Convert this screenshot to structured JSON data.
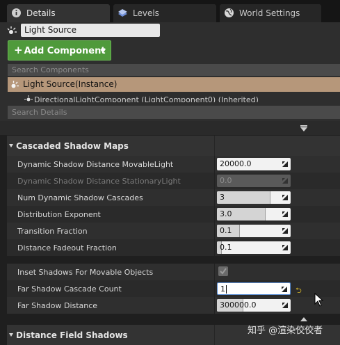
{
  "tabs": [
    {
      "label": "Details",
      "icon": "info-icon"
    },
    {
      "label": "Levels",
      "icon": "levels-icon"
    },
    {
      "label": "World Settings",
      "icon": "globe-icon"
    }
  ],
  "actor": {
    "name": "Light Source",
    "icon": "light-icon"
  },
  "toolbar": {
    "add_component_label": "Add Component",
    "plus": "+"
  },
  "search_components": {
    "placeholder": "Search Components"
  },
  "components": {
    "root_label": "Light Source(Instance)",
    "child_label": "DirectionalLightComponent (LightComponent0) (Inherited)"
  },
  "search_details": {
    "placeholder": "Search Details"
  },
  "categories": {
    "cascaded": "Cascaded Shadow Maps",
    "distance_field": "Distance Field Shadows"
  },
  "properties": [
    {
      "label": "Dynamic Shadow Distance MovableLight",
      "value": "20000.0",
      "enabled": true,
      "slider_fraction": 0
    },
    {
      "label": "Dynamic Shadow Distance StationaryLight",
      "value": "0.0",
      "enabled": false,
      "slider_fraction": 0
    },
    {
      "label": "Num Dynamic Shadow Cascades",
      "value": "3",
      "enabled": true,
      "slider_fraction": 0.72
    },
    {
      "label": "Distribution Exponent",
      "value": "3.0",
      "enabled": true,
      "slider_fraction": 0.65
    },
    {
      "label": "Transition Fraction",
      "value": "0.1",
      "enabled": true,
      "slider_fraction": 0.3
    },
    {
      "label": "Distance Fadeout Fraction",
      "value": "0.1",
      "enabled": true,
      "slider_fraction": 0.06
    },
    {
      "label": "Inset Shadows For Movable Objects",
      "checked": true,
      "enabled": false
    },
    {
      "label": "Far Shadow Cascade Count",
      "value": "1",
      "enabled": true,
      "editing": true
    },
    {
      "label": "Far Shadow Distance",
      "value": "300000.0",
      "enabled": true,
      "slider_fraction": 0.35
    }
  ],
  "watermark": "知乎 @渲染佼佼者",
  "colors": {
    "add_component_bg": "#4f9a3b",
    "selected_component_bg": "#b6977a",
    "reset_arrow": "#d4b42a"
  }
}
